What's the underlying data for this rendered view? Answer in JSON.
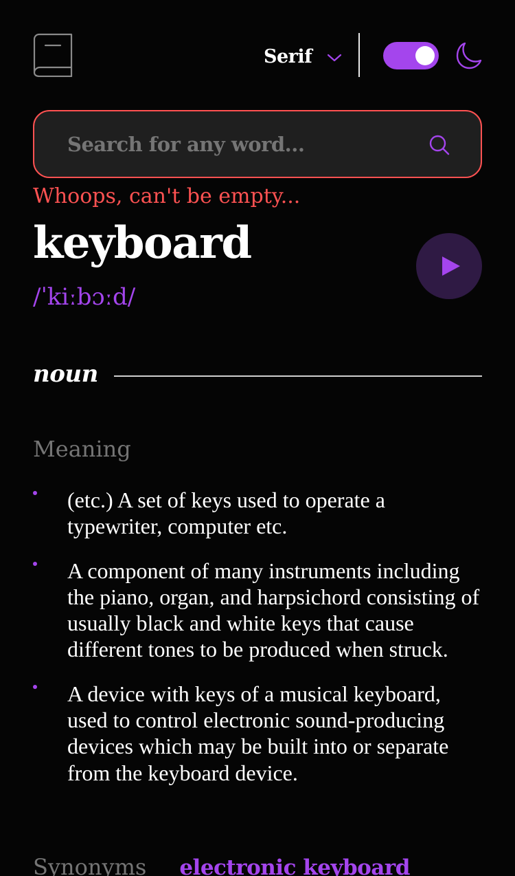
{
  "header": {
    "logo_icon": "book-icon",
    "font_selector": {
      "label": "Serif",
      "icon": "chevron-down-icon"
    },
    "theme_toggle": {
      "state": "on",
      "color": "#a445ed"
    },
    "theme_icon": "moon-icon"
  },
  "search": {
    "value": "",
    "placeholder": "Search for any word...",
    "icon": "search-icon",
    "error": "Whoops, can't be empty..."
  },
  "entry": {
    "word": "keyboard",
    "phonetic": "/ˈkiːbɔːd/",
    "play_icon": "play-icon",
    "meanings": [
      {
        "part_of_speech": "noun",
        "heading": "Meaning",
        "definitions": [
          "(etc.) A set of keys used to operate a typewriter, computer etc.",
          "A component of many instruments including the piano, organ, and harpsichord consisting of usually black and white keys that cause different tones to be produced when struck.",
          "A device with keys of a musical keyboard, used to control electronic sound-producing devices which may be built into or separate from the keyboard device."
        ],
        "synonyms_label": "Synonyms",
        "synonyms": [
          "electronic keyboard"
        ]
      }
    ]
  },
  "colors": {
    "background": "#050505",
    "accent": "#a445ed",
    "error": "#ff5252",
    "muted": "#757575"
  }
}
